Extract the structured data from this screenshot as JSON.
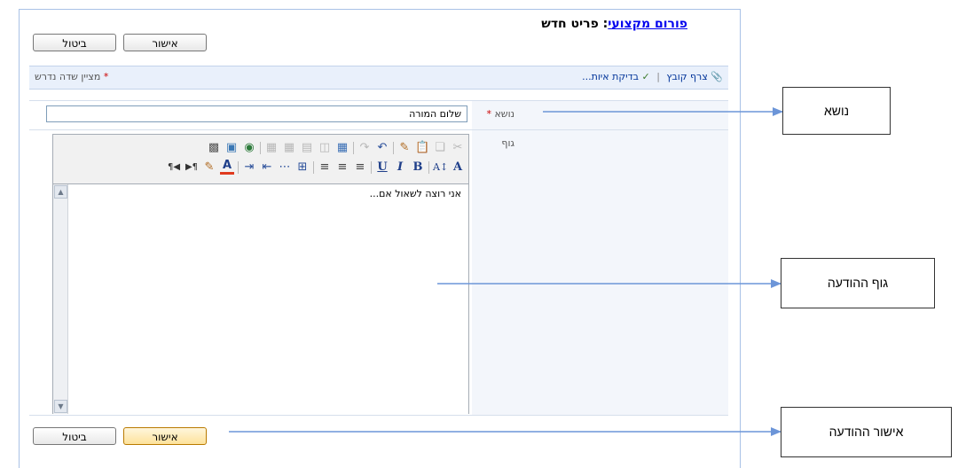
{
  "header": {
    "forum_link": "פורום מקצועי",
    "separator": ": ",
    "page_title": "פריט חדש"
  },
  "buttons": {
    "ok": "אישור",
    "cancel": "ביטול"
  },
  "toolbar": {
    "attach": "צרף קובץ",
    "divider": "|",
    "spell": "בדיקת איות...",
    "required_star": "*",
    "required_note": "מציין שדה נדרש"
  },
  "form": {
    "subject_label": "נושא",
    "subject_required": "*",
    "subject_value": "שלום המורה",
    "body_label": "גוף",
    "body_text": "אני רוצה לשאול אם..."
  },
  "editor_toolbar": {
    "row1": [
      "cut-icon",
      "copy-icon",
      "paste-icon",
      "format-painter-icon",
      "sep",
      "undo-icon",
      "redo-icon",
      "sep",
      "insert-table-icon",
      "insert-column-icon",
      "insert-row-icon",
      "merge-cells-icon",
      "table-properties-icon",
      "sep",
      "hyperlink-icon",
      "picture-icon",
      "web-part-icon"
    ],
    "row2": [
      "font-size-icon",
      "sep-",
      "bold-icon",
      "italic-icon",
      "underline-icon",
      "sep",
      "align-left-icon",
      "align-center-icon",
      "align-right-icon",
      "sep",
      "numbered-list-icon",
      "bulleted-list-icon",
      "decrease-indent-icon",
      "increase-indent-icon",
      "sep",
      "font-color-icon",
      "highlight-icon",
      "ltr-icon",
      "rtl-icon"
    ]
  },
  "callouts": {
    "subject": "נושא",
    "body": "גוף ההודעה",
    "submit": "אישור ההודעה"
  },
  "colors": {
    "frame_border": "#a9c2e6",
    "toolbar_bg": "#e9f0fb",
    "arrow": "#6c95d8",
    "required": "#cc0000",
    "link": "#0000ee"
  }
}
